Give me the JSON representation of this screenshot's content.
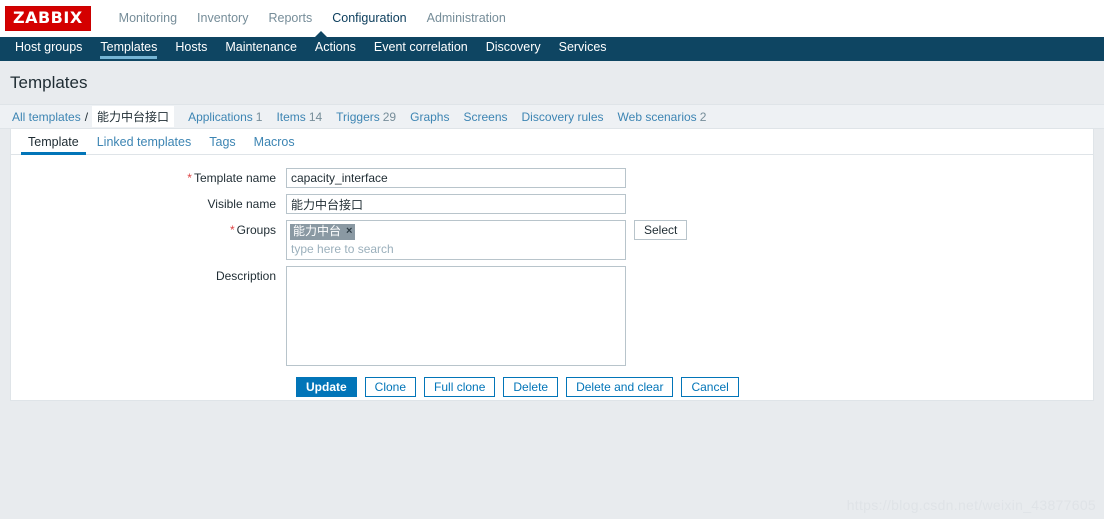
{
  "brand": {
    "logo_text": "ZABBIX",
    "logo_bg": "#d40000"
  },
  "topnav": {
    "items": [
      {
        "label": "Monitoring"
      },
      {
        "label": "Inventory"
      },
      {
        "label": "Reports"
      },
      {
        "label": "Configuration"
      },
      {
        "label": "Administration"
      }
    ],
    "active": "Configuration"
  },
  "subnav": {
    "items": [
      {
        "label": "Host groups"
      },
      {
        "label": "Templates"
      },
      {
        "label": "Hosts"
      },
      {
        "label": "Maintenance"
      },
      {
        "label": "Actions"
      },
      {
        "label": "Event correlation"
      },
      {
        "label": "Discovery"
      },
      {
        "label": "Services"
      }
    ],
    "active": "Templates",
    "bg": "#0e4562"
  },
  "page": {
    "title": "Templates"
  },
  "breadcrumb": {
    "root_label": "All templates",
    "separator": "/",
    "current_label": "能力中台接口",
    "links": [
      {
        "label": "Applications",
        "count": "1"
      },
      {
        "label": "Items",
        "count": "14"
      },
      {
        "label": "Triggers",
        "count": "29"
      },
      {
        "label": "Graphs",
        "count": ""
      },
      {
        "label": "Screens",
        "count": ""
      },
      {
        "label": "Discovery rules",
        "count": ""
      },
      {
        "label": "Web scenarios",
        "count": "2"
      }
    ]
  },
  "tabs": {
    "items": [
      {
        "label": "Template"
      },
      {
        "label": "Linked templates"
      },
      {
        "label": "Tags"
      },
      {
        "label": "Macros"
      }
    ],
    "active": "Template"
  },
  "form": {
    "template_name": {
      "label": "Template name",
      "required": "*",
      "value": "capacity_interface"
    },
    "visible_name": {
      "label": "Visible name",
      "required": "",
      "value": "能力中台接口"
    },
    "groups": {
      "label": "Groups",
      "required": "*",
      "chip_label": "能力中台",
      "chip_remove_icon": "×",
      "placeholder": "type here to search",
      "select_button": "Select"
    },
    "description": {
      "label": "Description",
      "value": ""
    },
    "buttons": [
      {
        "label": "Update",
        "style": "primary"
      },
      {
        "label": "Clone",
        "style": "secondary"
      },
      {
        "label": "Full clone",
        "style": "secondary"
      },
      {
        "label": "Delete",
        "style": "secondary"
      },
      {
        "label": "Delete and clear",
        "style": "secondary"
      },
      {
        "label": "Cancel",
        "style": "secondary"
      }
    ]
  },
  "watermark": {
    "text": "https://blog.csdn.net/weixin_43877605"
  },
  "colors": {
    "accent": "#0275b8",
    "navbar": "#0e4562",
    "link": "#3d85b3"
  }
}
